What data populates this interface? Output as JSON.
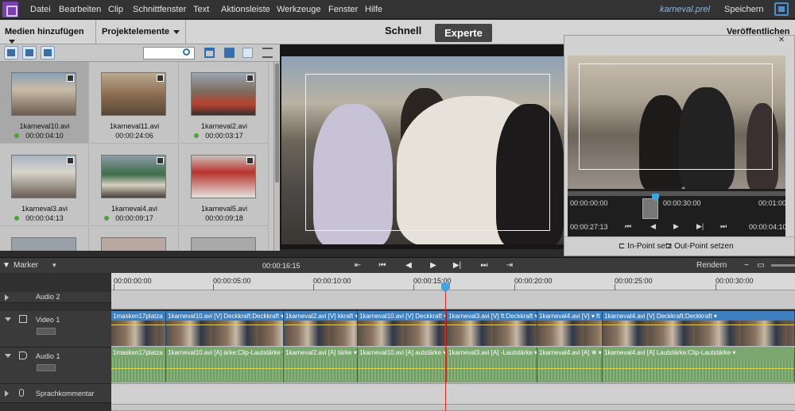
{
  "menu": {
    "items": [
      "Datei",
      "Bearbeiten",
      "Clip",
      "Schnittfenster",
      "Text",
      "Aktionsleiste",
      "Werkzeuge",
      "Fenster",
      "Hilfe"
    ],
    "project_title": "karneval.prel",
    "save": "Speichern"
  },
  "tabs": {
    "add_media": "Medien hinzufügen",
    "project_assets": "Projektelemente",
    "quick": "Schnell",
    "expert": "Experte",
    "publish": "Veröffentlichen"
  },
  "media": {
    "clips": [
      {
        "name": "1karneval10.avi",
        "duration": "00:00:04:10",
        "used": true
      },
      {
        "name": "1karneval11.avi",
        "duration": "00:00:24:06",
        "used": false
      },
      {
        "name": "1karneval2.avi",
        "duration": "00:00:03:17",
        "used": true
      },
      {
        "name": "1karneval3.avi",
        "duration": "00:00:04:13",
        "used": true
      },
      {
        "name": "1karneval4.avi",
        "duration": "00:00:09:17",
        "used": true
      },
      {
        "name": "1karneval5.avi",
        "duration": "00:00:09:18",
        "used": false
      }
    ]
  },
  "preview": {
    "time_start": "00:00:00:00",
    "time_mid": "00:00:30:00",
    "time_end": "00:01:00",
    "current": "00:00:27:13",
    "duration": "00:00:04:10",
    "in_point": "In-Point setz",
    "out_point": "Out-Point setzen"
  },
  "timeline": {
    "marker": "Marker",
    "current_time": "00:00:16:15",
    "render": "Rendern",
    "ruler": [
      "00:00:00:00",
      "00:00:05:00",
      "00:00:10:00",
      "00:00:15:00",
      "00:00:20:00",
      "00:00:25:00",
      "00:00:30:00"
    ],
    "tracks": {
      "audio2": "Audio 2",
      "video1": "Video 1",
      "audio1": "Audio 1",
      "narration": "Sprachkommentar"
    },
    "video_clips": [
      "1masken17platza",
      "1karneval10.avi [V]  Deckkraft:Deckkraft ▾",
      "1karneval2.avi [V]  kkraft ▾",
      "1karneval10.avi [V]  Deckkraft ▾",
      "1karneval3.avi [V]  ft:Deckkraft ▾",
      "1karneval4.avi [V]  ▾ ft ▾",
      "1karneval4.avi [V]  Deckkraft:Deckkraft ▾"
    ],
    "audio_clips": [
      "1masken17platza",
      "1karneval10.avi [A]  ärke:Clip-Lautstärke ▾",
      "1karneval2.avi [A]  tärke ▾",
      "1karneval10.avi [A]  autstärke ▾",
      "1karneval3.avi [A]  -Lautstärke ▾",
      "1karneval4.avi [A]  ✻ ▾",
      "1karneval4.avi [A]  Lautstärke:Clip-Lautstärke ▾"
    ]
  }
}
